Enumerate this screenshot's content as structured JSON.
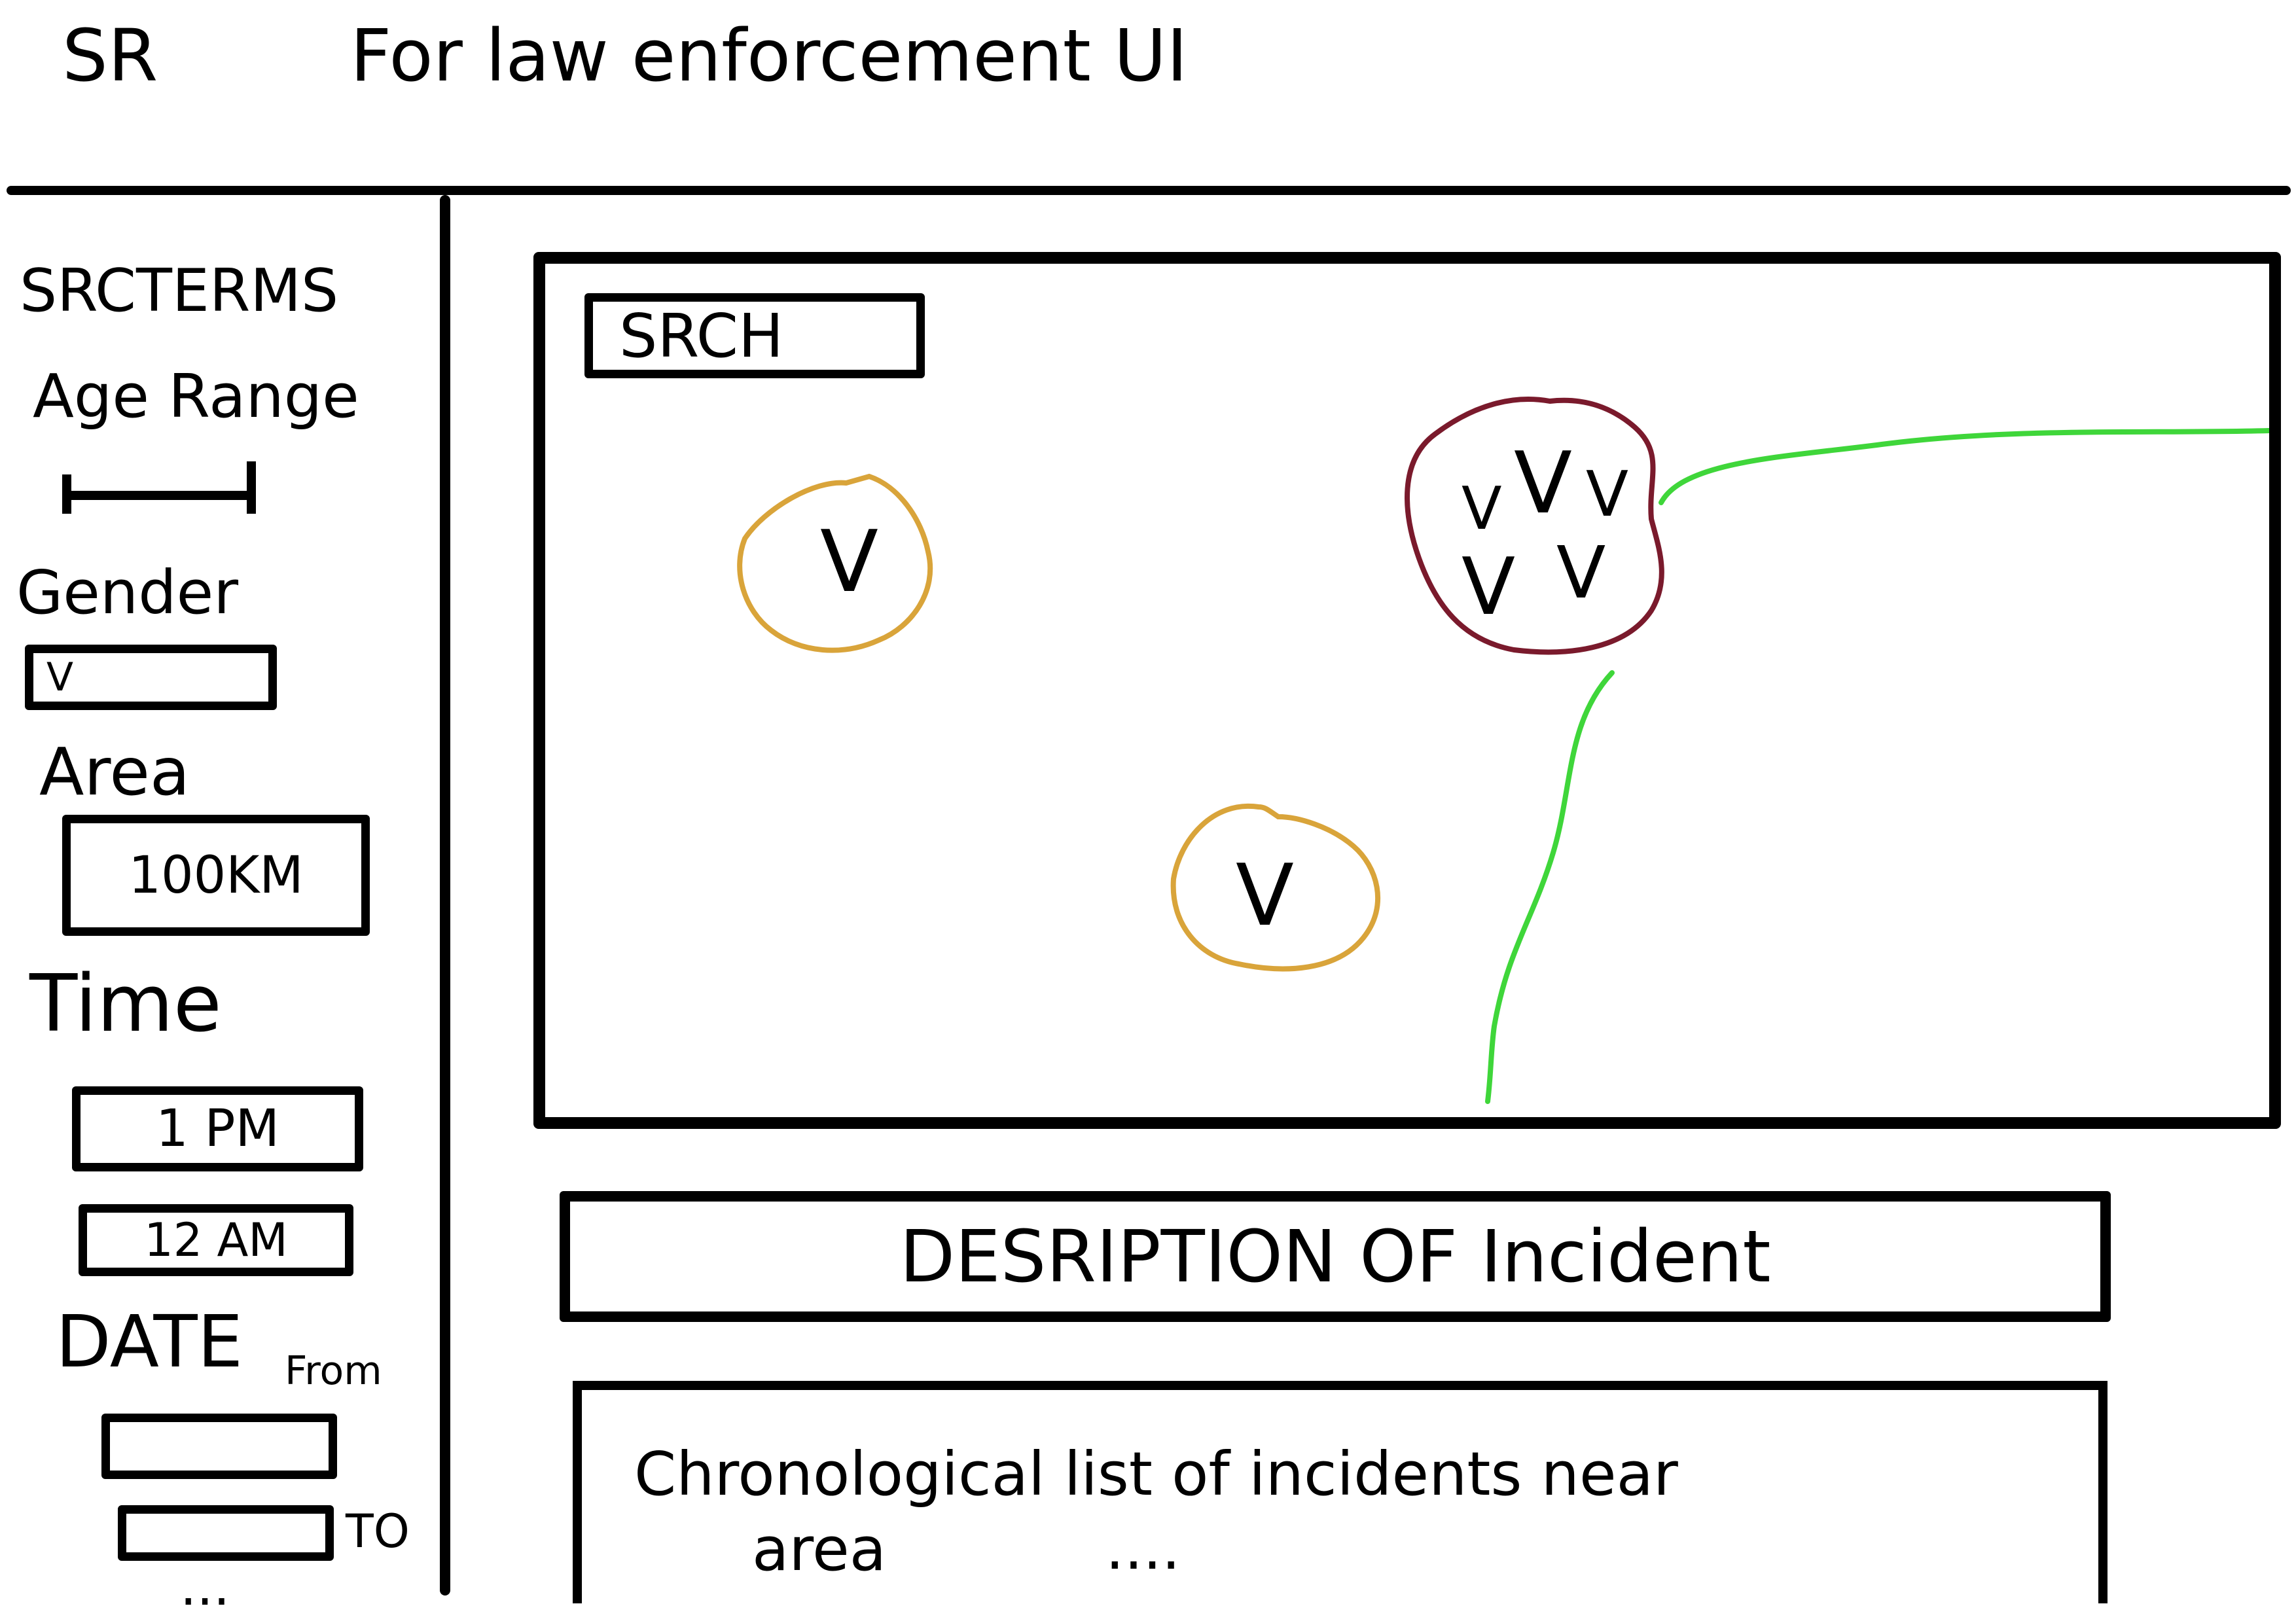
{
  "header": {
    "app_title": "SR",
    "subtitle": "For law enforcement UI"
  },
  "sidebar": {
    "search_terms_label": "SRCTERMS",
    "age_range_label": "Age Range",
    "gender_label": "Gender",
    "gender_value": "V",
    "area_label": "Area",
    "area_value": "100KM",
    "time_label": "Time",
    "time_from": "1 PM",
    "time_to": "12 AM",
    "date_label": "DATE",
    "date_from_label": "From",
    "date_from_value": "",
    "date_to_label": "TO",
    "date_to_value": "",
    "more": "..."
  },
  "map": {
    "search_label": "SRCH",
    "marker_glyph": "V",
    "clusters": [
      {
        "id": "cluster-a",
        "color": "#d9a43a",
        "markers": 1
      },
      {
        "id": "cluster-b",
        "color": "#7a1a2c",
        "markers": 5
      },
      {
        "id": "cluster-c",
        "color": "#d9a43a",
        "markers": 1
      }
    ],
    "route_color": "#3fd63a"
  },
  "description": {
    "label": "DESRIPTION OF Incident"
  },
  "incident_list": {
    "title_line1": "Chronological list of incidents near",
    "title_line2": "area",
    "more": "...."
  }
}
